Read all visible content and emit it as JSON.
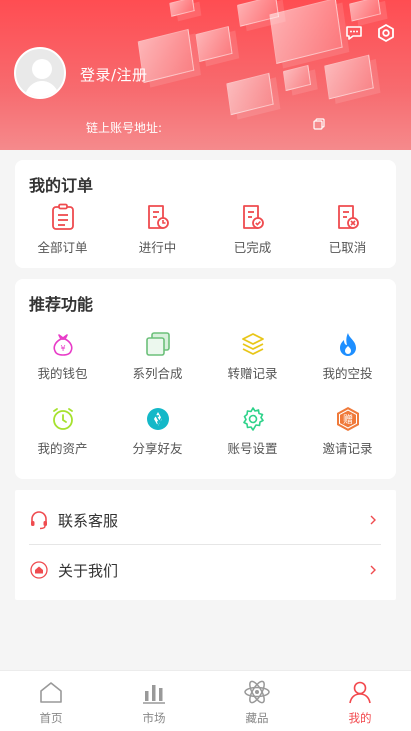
{
  "header": {
    "login_label": "登录/注册",
    "chain_address_label": "链上账号地址:",
    "gradient_top": "#ff4d52",
    "gradient_bottom": "#f58a8c"
  },
  "orders": {
    "title": "我的订单",
    "items": [
      {
        "label": "全部订单",
        "icon": "clipboard-list-icon"
      },
      {
        "label": "进行中",
        "icon": "document-progress-icon"
      },
      {
        "label": "已完成",
        "icon": "document-check-icon"
      },
      {
        "label": "已取消",
        "icon": "document-cancel-icon"
      }
    ]
  },
  "features": {
    "title": "推荐功能",
    "items": [
      {
        "label": "我的钱包",
        "icon": "money-bag-icon",
        "color": "#e83cc8"
      },
      {
        "label": "系列合成",
        "icon": "layers-copy-icon",
        "color": "#6cc07a"
      },
      {
        "label": "转赠记录",
        "icon": "stack-layers-icon",
        "color": "#e8c619"
      },
      {
        "label": "我的空投",
        "icon": "flame-icon",
        "color": "#1e8fff"
      },
      {
        "label": "我的资产",
        "icon": "alarm-clock-icon",
        "color": "#a6e22e"
      },
      {
        "label": "分享好友",
        "icon": "aperture-icon",
        "color": "#14b8c8"
      },
      {
        "label": "账号设置",
        "icon": "gear-icon",
        "color": "#2ed28a"
      },
      {
        "label": "邀请记录",
        "icon": "hexagon-gift-icon",
        "color": "#f07a3a",
        "badge": "赠"
      }
    ]
  },
  "service": {
    "items": [
      {
        "label": "联系客服",
        "icon": "headset-icon"
      },
      {
        "label": "关于我们",
        "icon": "home-circle-icon"
      }
    ]
  },
  "tabbar": {
    "accent": "#f2484d",
    "items": [
      {
        "label": "首页",
        "icon": "home-icon",
        "active": false
      },
      {
        "label": "市场",
        "icon": "bar-chart-icon",
        "active": false
      },
      {
        "label": "藏品",
        "icon": "atom-icon",
        "active": false
      },
      {
        "label": "我的",
        "icon": "user-icon",
        "active": true
      }
    ]
  }
}
